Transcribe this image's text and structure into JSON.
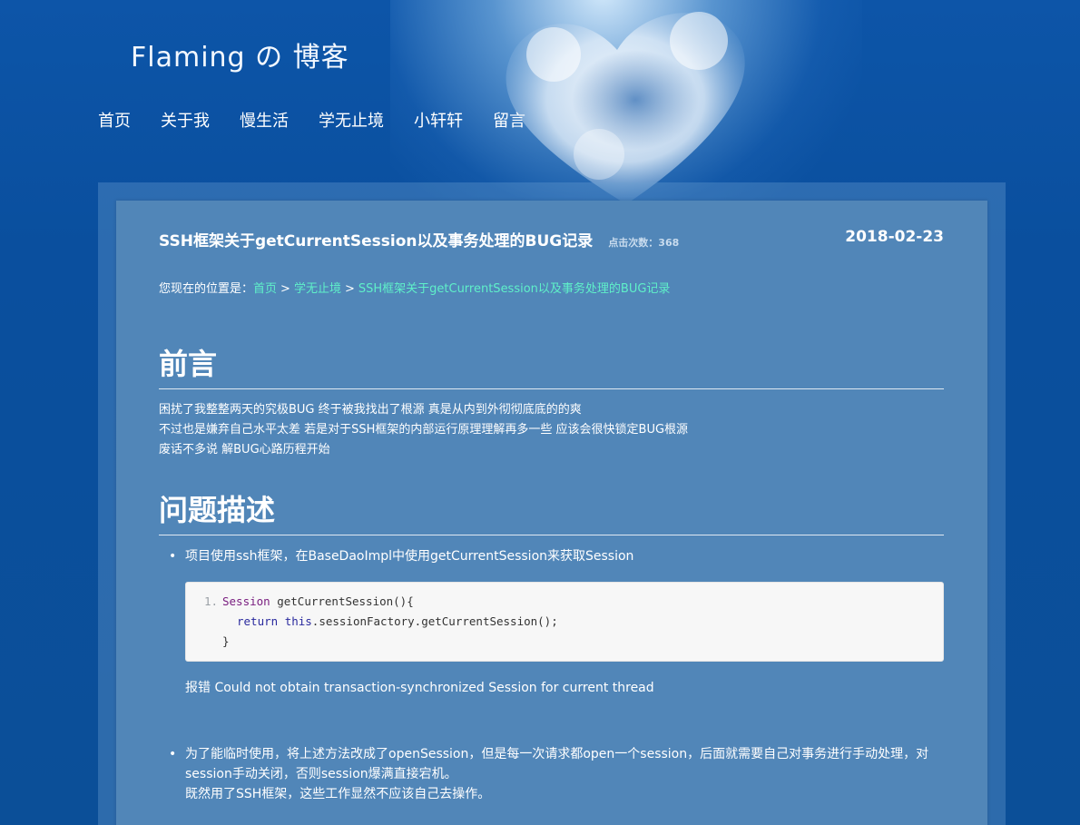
{
  "site": {
    "title": "Flaming の 博客"
  },
  "nav": {
    "items": [
      "首页",
      "关于我",
      "慢生活",
      "学无止境",
      "小轩轩",
      "留言"
    ]
  },
  "article": {
    "title": "SSH框架关于getCurrentSession以及事务处理的BUG记录",
    "hits_label": "点击次数：368",
    "date": "2018-02-23"
  },
  "breadcrumb": {
    "prefix": "您现在的位置是：",
    "home": "首页",
    "category": "学无止境",
    "current": "SSH框架关于getCurrentSession以及事务处理的BUG记录",
    "sep": ">"
  },
  "sections": {
    "preface_heading": "前言",
    "preface_lines": [
      "困扰了我整整两天的究极BUG 终于被我找出了根源 真是从内到外彻彻底底的的爽",
      "不过也是嫌弃自己水平太差 若是对于SSH框架的内部运行原理理解再多一些 应该会很快锁定BUG根源",
      "废话不多说 解BUG心路历程开始"
    ],
    "problem_heading": "问题描述",
    "bullet1": "项目使用ssh框架，在BaseDaoImpl中使用getCurrentSession来获取Session",
    "code": {
      "line_no": "1.",
      "line1_type": "Session",
      "line1_rest": " getCurrentSession(){",
      "line2_kw": "return",
      "line2_this": "this",
      "line2_rest": ".sessionFactory.getCurrentSession();",
      "line3": "}"
    },
    "error_text": "报错 Could not obtain transaction-synchronized Session for current thread",
    "bullet2_lines": [
      "为了能临时使用，将上述方法改成了openSession，但是每一次请求都open一个session，后面就需要自己对事务进行手动处理，对",
      "session手动关闭，否则session爆满直接宕机。",
      "既然用了SSH框架，这些工作显然不应该自己去操作。"
    ]
  }
}
